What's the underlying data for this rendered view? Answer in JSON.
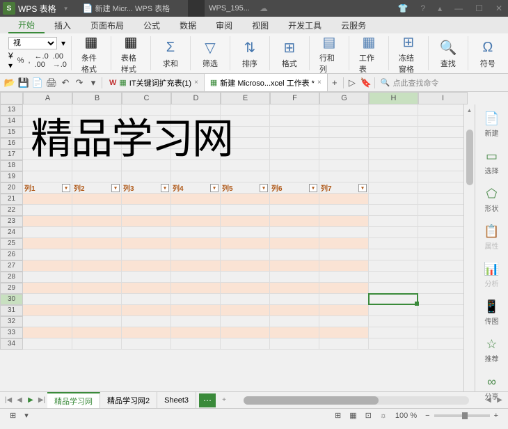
{
  "title_bar": {
    "app_name": "WPS 表格",
    "doc1": "新建 Micr... WPS 表格",
    "user": "WPS_195..."
  },
  "menu": {
    "items": [
      "开始",
      "插入",
      "页面布局",
      "公式",
      "数据",
      "审阅",
      "视图",
      "开发工具",
      "云服务"
    ]
  },
  "toolbar": {
    "font": "视",
    "percent": "%",
    "decimal_dec": ".0",
    "decimal_inc": ".00",
    "cond_format": "条件格式",
    "table_style": "表格样式",
    "sum": "求和",
    "filter": "筛选",
    "sort": "排序",
    "format": "格式",
    "rowcol": "行和列",
    "worksheet": "工作表",
    "freeze": "冻结窗格",
    "find": "查找",
    "symbol": "符号"
  },
  "doc_tabs": {
    "tab1": "IT关键词扩充表(1)",
    "tab2": "新建 Microso...xcel 工作表 *"
  },
  "search_cmd": "点此查找命令",
  "columns": [
    "A",
    "B",
    "C",
    "D",
    "E",
    "F",
    "G",
    "H",
    "I"
  ],
  "row_start": 13,
  "row_end": 34,
  "table_headers": [
    "列1",
    "列2",
    "列3",
    "列4",
    "列5",
    "列6",
    "列7"
  ],
  "overlay_text": "精品学习网",
  "sidebar": {
    "items": [
      {
        "label": "新建",
        "icon": "📄"
      },
      {
        "label": "选择",
        "icon": "▭"
      },
      {
        "label": "形状",
        "icon": "⬠"
      },
      {
        "label": "属性",
        "icon": "📋"
      },
      {
        "label": "分析",
        "icon": "📊"
      },
      {
        "label": "传图",
        "icon": "📱"
      },
      {
        "label": "推荐",
        "icon": "☆"
      },
      {
        "label": "分享",
        "icon": "�share"
      }
    ]
  },
  "sheet_tabs": [
    "精品学习网",
    "精品学习网2",
    "Sheet3"
  ],
  "zoom": "100 %"
}
